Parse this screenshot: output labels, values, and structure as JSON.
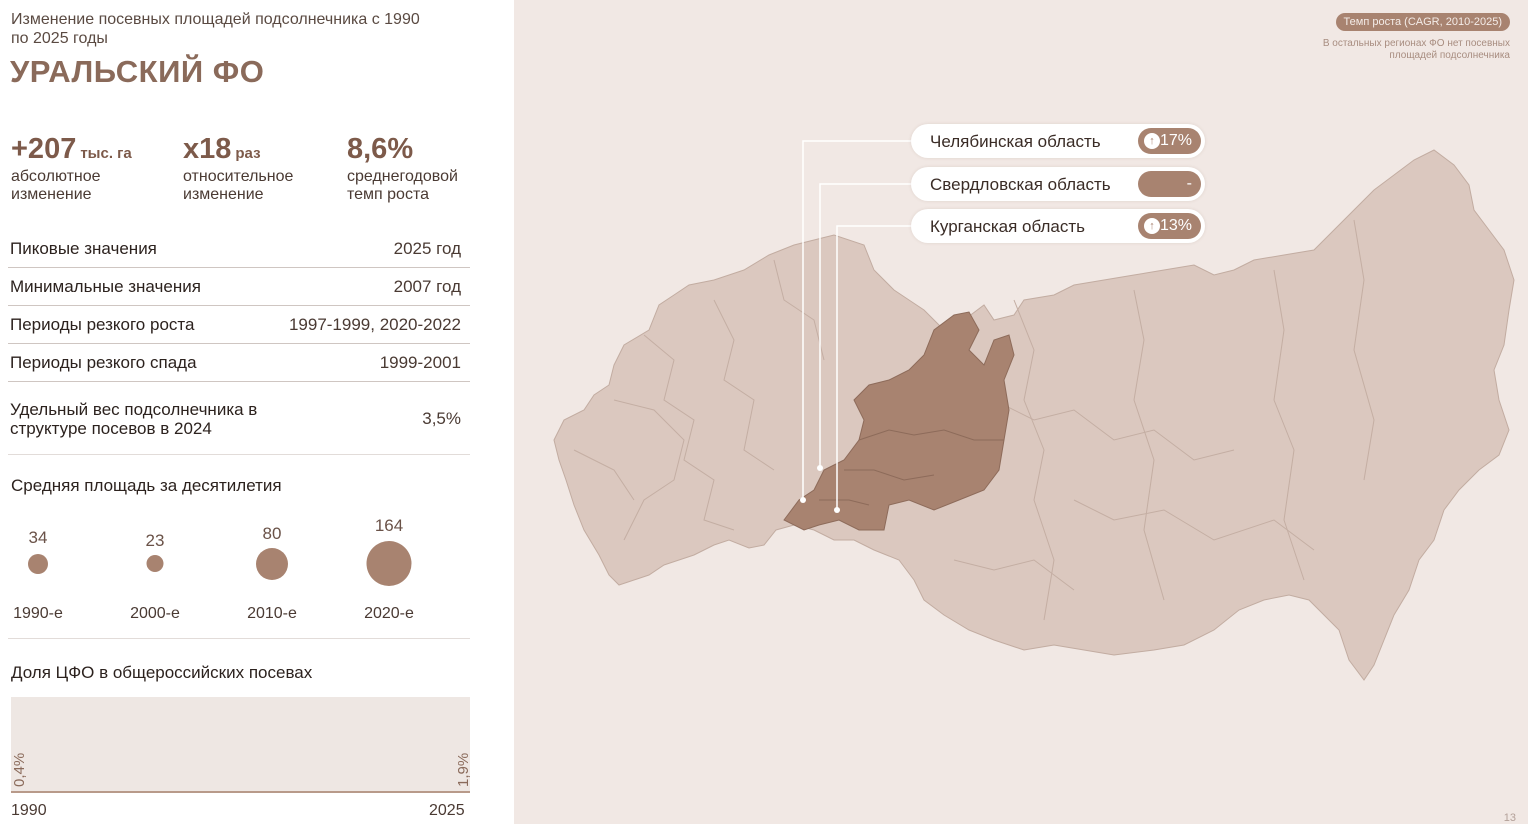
{
  "header": {
    "subtitle": "Изменение посевных площадей подсолнечника с 1990 по 2025 годы",
    "region": "УРАЛЬСКИЙ ФО"
  },
  "kpis": [
    {
      "value": "+207",
      "unit": "тыс. га",
      "label": "абсолютное изменение"
    },
    {
      "value": "x18",
      "unit": "раз",
      "label": "относительное изменение"
    },
    {
      "value": "8,6%",
      "unit": "",
      "label": "среднегодовой темп роста"
    }
  ],
  "facts": [
    {
      "key": "Пиковые значения",
      "value": "2025 год"
    },
    {
      "key": "Минимальные значения",
      "value": "2007 год"
    },
    {
      "key": "Периоды резкого роста",
      "value": "1997-1999, 2020-2022"
    },
    {
      "key": "Периоды резкого спада",
      "value": "1999-2001"
    },
    {
      "key": "Удельный вес подсолнечника в структуре посевов в 2024",
      "value": "3,5%"
    }
  ],
  "decades": {
    "title": "Средняя площадь за десятилетия",
    "items": [
      {
        "label": "1990-е",
        "value": "34"
      },
      {
        "label": "2000-е",
        "value": "23"
      },
      {
        "label": "2010-е",
        "value": "80"
      },
      {
        "label": "2020-е",
        "value": "164"
      }
    ]
  },
  "share": {
    "title": "Доля ЦФО в общероссийских посевах",
    "start_value": "0,4%",
    "end_value": "1,9%",
    "start_year": "1990",
    "end_year": "2025"
  },
  "map": {
    "legend_label": "Темп роста (CAGR, 2010-2025)",
    "legend_note": "В остальных регионах ФО нет посевных площадей подсолнечника",
    "page_number": "13",
    "highlight_color": "#a88370",
    "base_color": "#dbc8bf",
    "callouts": [
      {
        "name": "Челябинская область",
        "growth": "17%",
        "arrow": "up"
      },
      {
        "name": "Свердловская область",
        "growth": "-",
        "arrow": "none"
      },
      {
        "name": "Курганская область",
        "growth": "13%",
        "arrow": "up"
      }
    ]
  }
}
